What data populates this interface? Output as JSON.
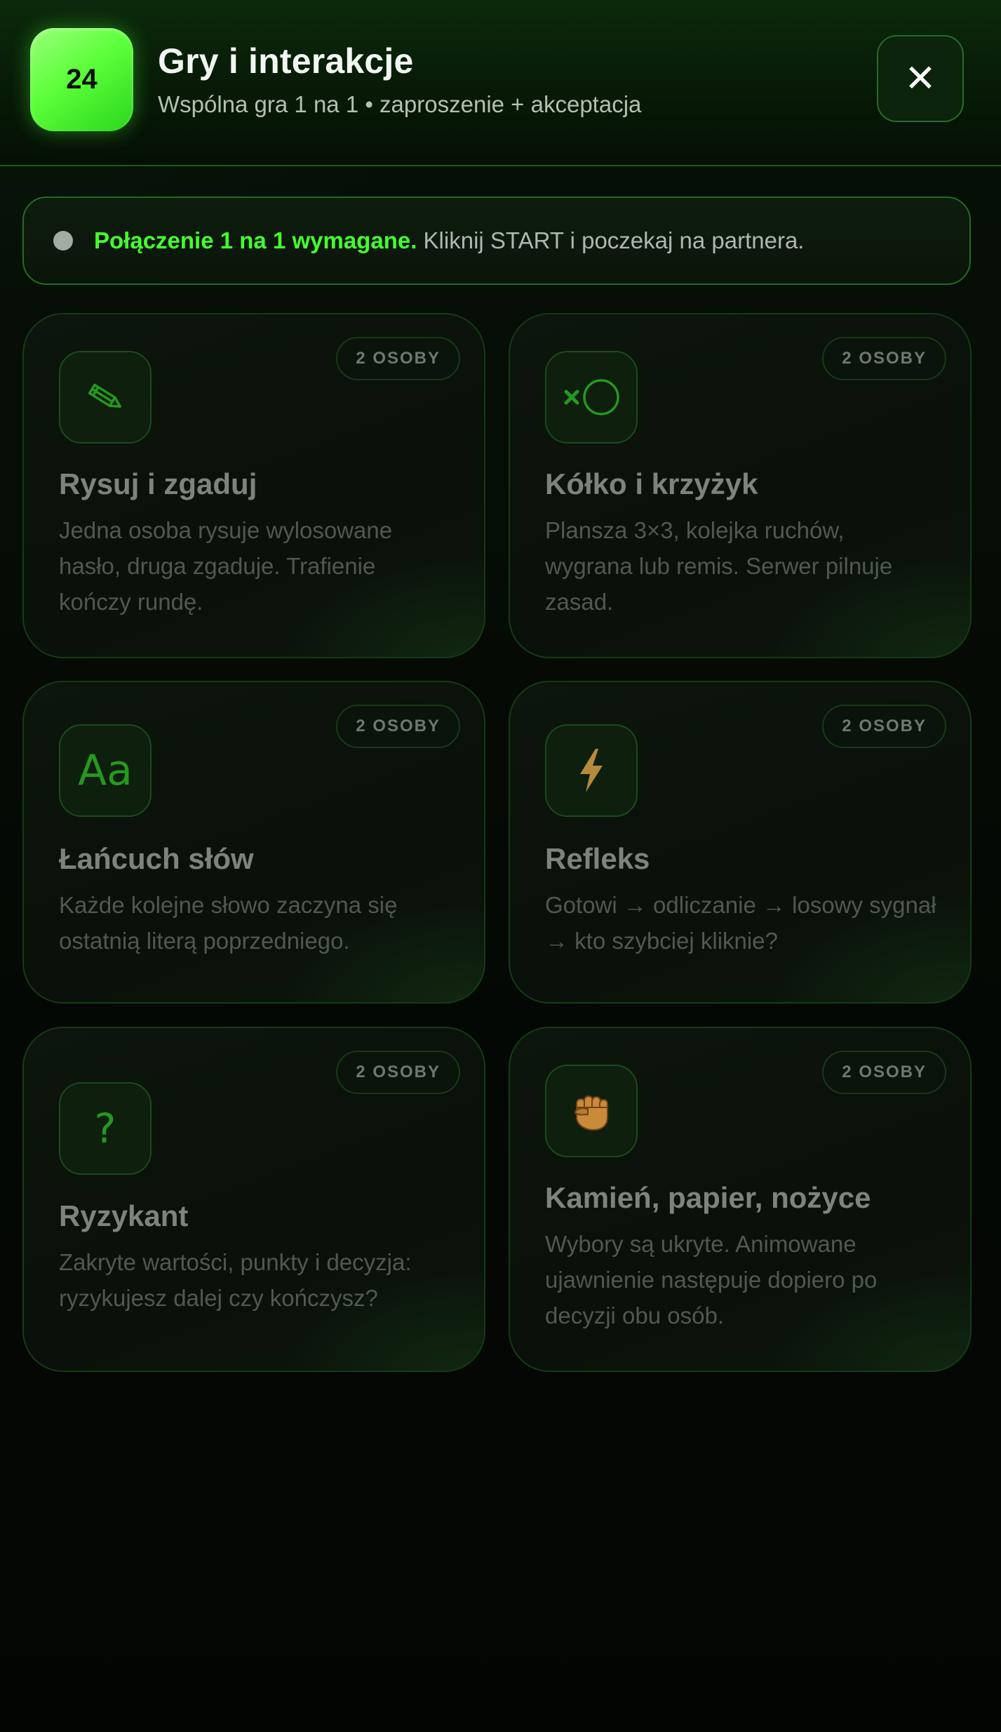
{
  "header": {
    "badge": "24",
    "title": "Gry i interakcje",
    "subtitle": "Wspólna gra 1 na 1 • zaproszenie + akceptacja",
    "close_label": "✕"
  },
  "notice": {
    "strong": "Połączenie 1 na 1 wymagane.",
    "text": " Kliknij START i poczekaj na partnera."
  },
  "games": [
    {
      "icon": "pencil-icon",
      "title": "Rysuj i zgaduj",
      "desc": "Jedna osoba rysuje wylosowane hasło, druga zgaduje. Trafienie kończy rundę.",
      "players": "2 OSOBY"
    },
    {
      "icon": "tic-tac-toe-icon",
      "title": "Kółko i krzyżyk",
      "desc": "Plansza 3×3, kolejka ruchów, wygrana lub remis. Serwer pilnuje zasad.",
      "players": "2 OSOBY"
    },
    {
      "icon": "letters-icon",
      "glyph": "Aa",
      "title": "Łańcuch słów",
      "desc": "Każde kolejne słowo zaczyna się ostatnią literą poprzedniego.",
      "players": "2 OSOBY"
    },
    {
      "icon": "lightning-icon",
      "title": "Refleks",
      "desc": "Gotowi → odliczanie → losowy sygnał → kto szybciej kliknie?",
      "players": "2 OSOBY"
    },
    {
      "icon": "question-icon",
      "glyph": "?",
      "title": "Ryzykant",
      "desc": "Zakryte wartości, punkty i decyzja: ryzykujesz dalej czy kończysz?",
      "players": "2 OSOBY"
    },
    {
      "icon": "fist-icon",
      "title": "Kamień, papier, nożyce",
      "desc": "Wybory są ukryte. Animowane ujawnienie następuje dopiero po decyzji obu osób.",
      "players": "2 OSOBY"
    }
  ],
  "colors": {
    "accent": "#44ff2e",
    "badge": "#5cff3a",
    "icon_green": "#25991f"
  }
}
